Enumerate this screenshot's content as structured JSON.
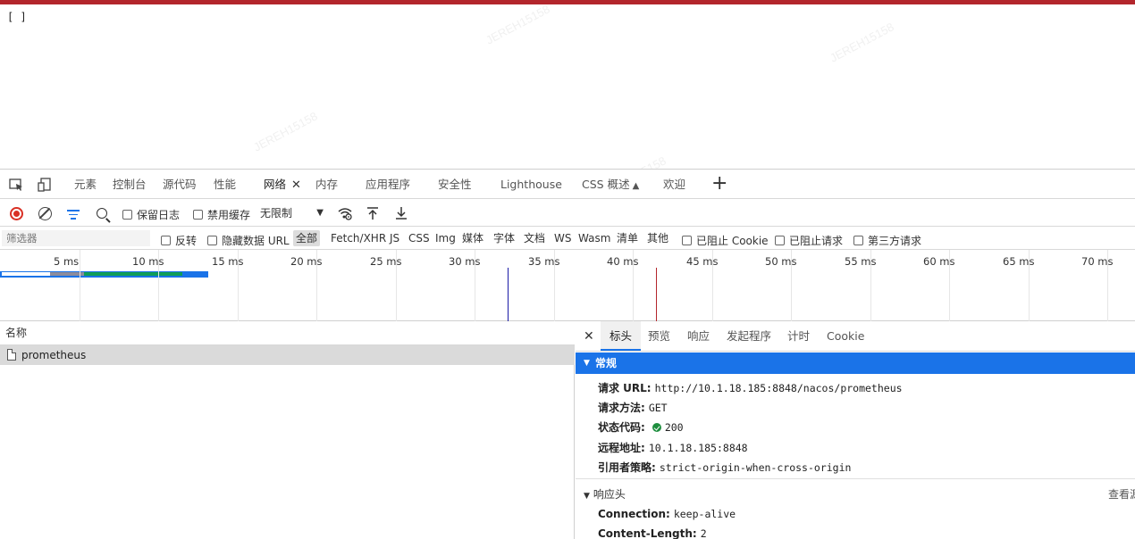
{
  "page": {
    "content": "[ ]"
  },
  "watermark": "JEREH15158",
  "devtools": {
    "tabs": [
      {
        "label": "元素"
      },
      {
        "label": "控制台"
      },
      {
        "label": "源代码"
      },
      {
        "label": "性能"
      },
      {
        "label": "网络"
      },
      {
        "label": "内存"
      },
      {
        "label": "应用程序"
      },
      {
        "label": "安全性"
      },
      {
        "label": "Lighthouse"
      },
      {
        "label": "CSS 概述"
      },
      {
        "label": "欢迎"
      }
    ],
    "toolbar": {
      "preserve_log": "保留日志",
      "disable_cache": "禁用缓存",
      "throttle": "无限制"
    },
    "filter": {
      "placeholder": "筛选器",
      "invert": "反转",
      "hide_data_urls": "隐藏数据 URL",
      "types": [
        "全部",
        "Fetch/XHR",
        "JS",
        "CSS",
        "Img",
        "媒体",
        "字体",
        "文档",
        "WS",
        "Wasm",
        "清单",
        "其他"
      ],
      "blocked_cookies": "已阻止 Cookie",
      "blocked_requests": "已阻止请求",
      "third_party": "第三方请求"
    },
    "overview": {
      "ticks": [
        "5 ms",
        "10 ms",
        "15 ms",
        "20 ms",
        "25 ms",
        "30 ms",
        "35 ms",
        "40 ms",
        "45 ms",
        "50 ms",
        "55 ms",
        "60 ms",
        "65 ms",
        "70 ms"
      ],
      "colors": {
        "dom_content_loaded": "#1a1aa6",
        "load": "#b3262c",
        "waiting": "#0f9d58",
        "download": "#1a73e8",
        "queue": "#8c8c9c"
      }
    },
    "requests": {
      "header": "名称",
      "rows": [
        {
          "name": "prometheus"
        }
      ]
    },
    "details": {
      "tabs": [
        "标头",
        "预览",
        "响应",
        "发起程序",
        "计时",
        "Cookie"
      ],
      "general_title": "常规",
      "general": {
        "url_key": "请求 URL:",
        "url_val": "http://10.1.18.185:8848/nacos/prometheus",
        "method_key": "请求方法:",
        "method_val": "GET",
        "status_key": "状态代码:",
        "status_val": "200",
        "remote_key": "远程地址:",
        "remote_val": "10.1.18.185:8848",
        "referrer_key": "引用者策略:",
        "referrer_val": "strict-origin-when-cross-origin"
      },
      "response_title": "响应头",
      "view_source": "查看源",
      "response": {
        "conn_key": "Connection:",
        "conn_val": "keep-alive",
        "len_key": "Content-Length:",
        "len_val": "2"
      }
    }
  }
}
